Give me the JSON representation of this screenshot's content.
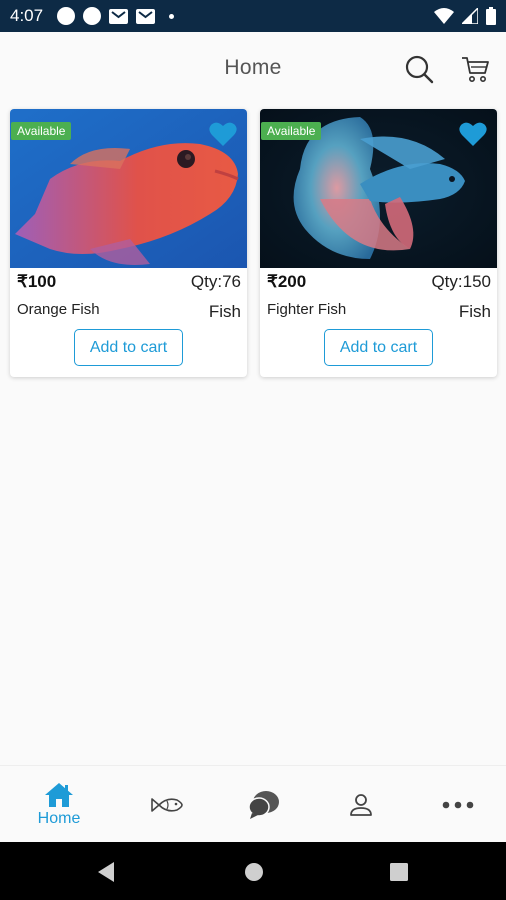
{
  "status_bar": {
    "time": "4:07"
  },
  "header": {
    "title": "Home"
  },
  "products": [
    {
      "badge": "Available",
      "price": "₹100",
      "qty": "Qty:76",
      "name": "Orange Fish",
      "category": "Fish",
      "button": "Add to cart"
    },
    {
      "badge": "Available",
      "price": "₹200",
      "qty": "Qty:150",
      "name": "Fighter Fish",
      "category": "Fish",
      "button": "Add to cart"
    }
  ],
  "bottom_nav": {
    "home_label": "Home"
  },
  "colors": {
    "accent": "#1e9bd7",
    "badge": "#4caf50",
    "status_bar": "#0d2a45"
  }
}
